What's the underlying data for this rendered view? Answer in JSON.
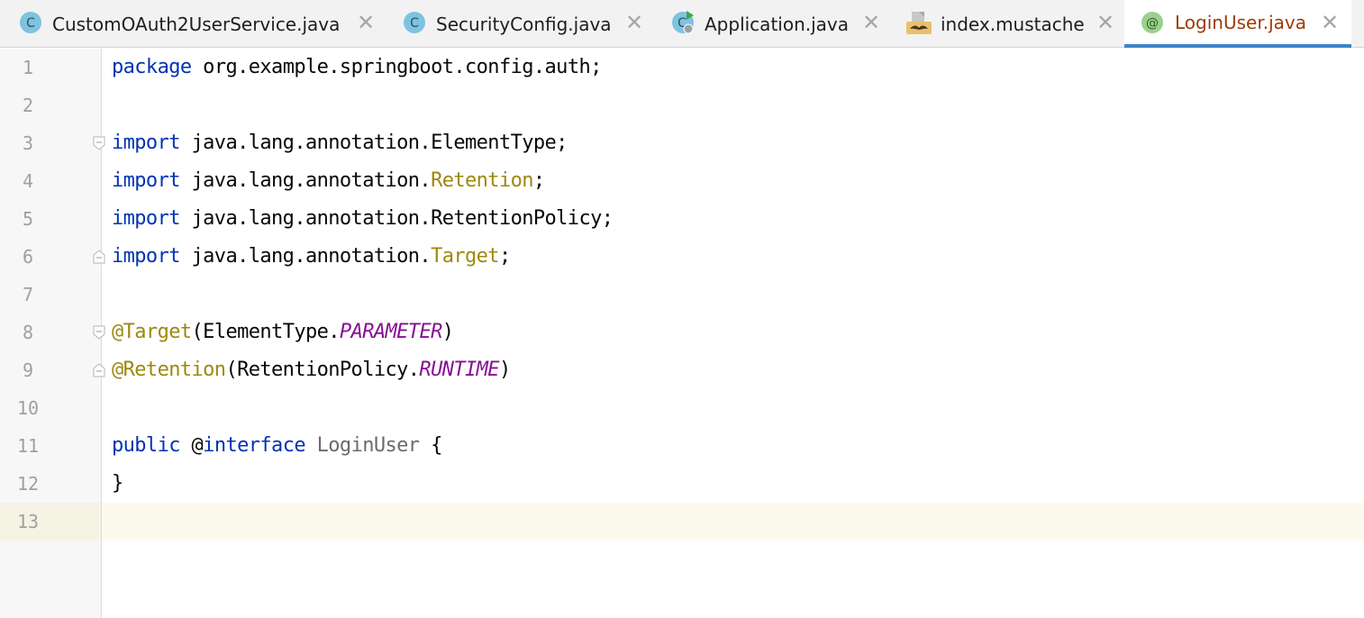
{
  "tabs": [
    {
      "label": "CustomOAuth2UserService.java",
      "icon": "class-icon"
    },
    {
      "label": "SecurityConfig.java",
      "icon": "class-icon"
    },
    {
      "label": "Application.java",
      "icon": "runnable-class-icon"
    },
    {
      "label": "index.mustache",
      "icon": "mustache-icon"
    },
    {
      "label": "LoginUser.java",
      "icon": "annotation-icon",
      "active": true
    }
  ],
  "close_glyph": "✕",
  "icon_letters": {
    "class": "C",
    "annotation": "@"
  },
  "line_numbers": [
    "1",
    "2",
    "3",
    "4",
    "5",
    "6",
    "7",
    "8",
    "9",
    "10",
    "11",
    "12",
    "13"
  ],
  "code": {
    "l1": {
      "kw": "package",
      "rest": " org.example.springboot.config.auth;"
    },
    "l3": {
      "kw": "import",
      "rest": " java.lang.annotation.ElementType;"
    },
    "l4": {
      "kw": "import",
      "rest": " java.lang.annotation.",
      "ann": "Retention",
      "end": ";"
    },
    "l5": {
      "kw": "import",
      "rest": " java.lang.annotation.RetentionPolicy;"
    },
    "l6": {
      "kw": "import",
      "rest": " java.lang.annotation.",
      "ann": "Target",
      "end": ";"
    },
    "l8": {
      "ann": "@Target",
      "open": "(ElementType.",
      "it": "PARAMETER",
      "close": ")"
    },
    "l9": {
      "ann": "@Retention",
      "open": "(RetentionPolicy.",
      "it": "RUNTIME",
      "close": ")"
    },
    "l11": {
      "kw": "public",
      "sp": " @",
      "kw2": "interface",
      "name": " LoginUser",
      "brace": " {"
    },
    "l12": {
      "brace": "}"
    }
  },
  "colors": {
    "keyword": "#0033b3",
    "annotation": "#9e880d",
    "constant": "#871094",
    "active_tab_text": "#9c3c08",
    "active_tab_underline": "#4083c9",
    "caret_line": "#fcfaed"
  }
}
